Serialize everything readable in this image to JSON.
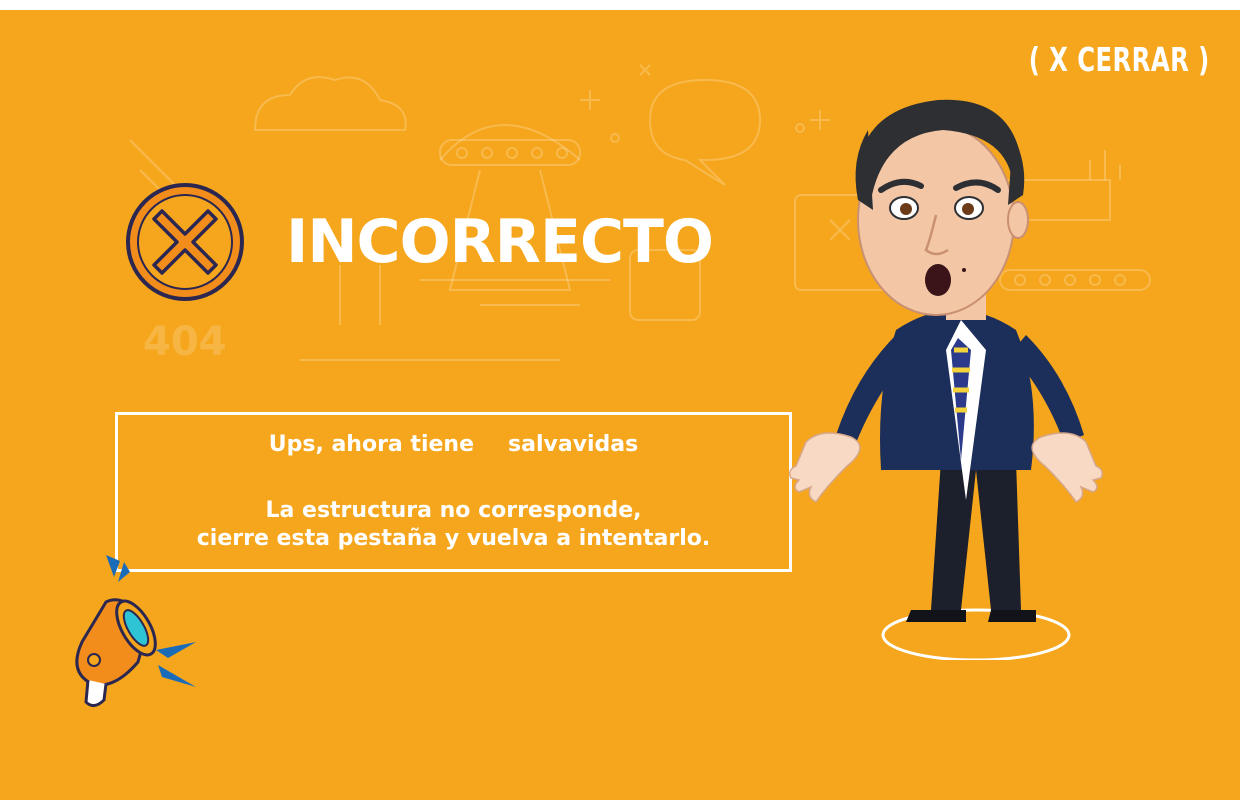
{
  "close_button": {
    "label": "( X CERRAR )"
  },
  "header": {
    "title": "INCORRECTO"
  },
  "message": {
    "line1_part1": "Ups, ahora tiene",
    "line1_part2": "salvavidas",
    "line2": "La estructura no corresponde,",
    "line3": "cierre esta pestaña y vuelva a intentarlo."
  },
  "background_art": {
    "error_code_label": "404"
  },
  "icons": {
    "status": "close-x-icon",
    "megaphone": "megaphone-icon"
  },
  "colors": {
    "background": "#f6a61c",
    "badge_fill": "#f28d1b",
    "badge_outline": "#2b2750",
    "text": "#ffffff"
  }
}
